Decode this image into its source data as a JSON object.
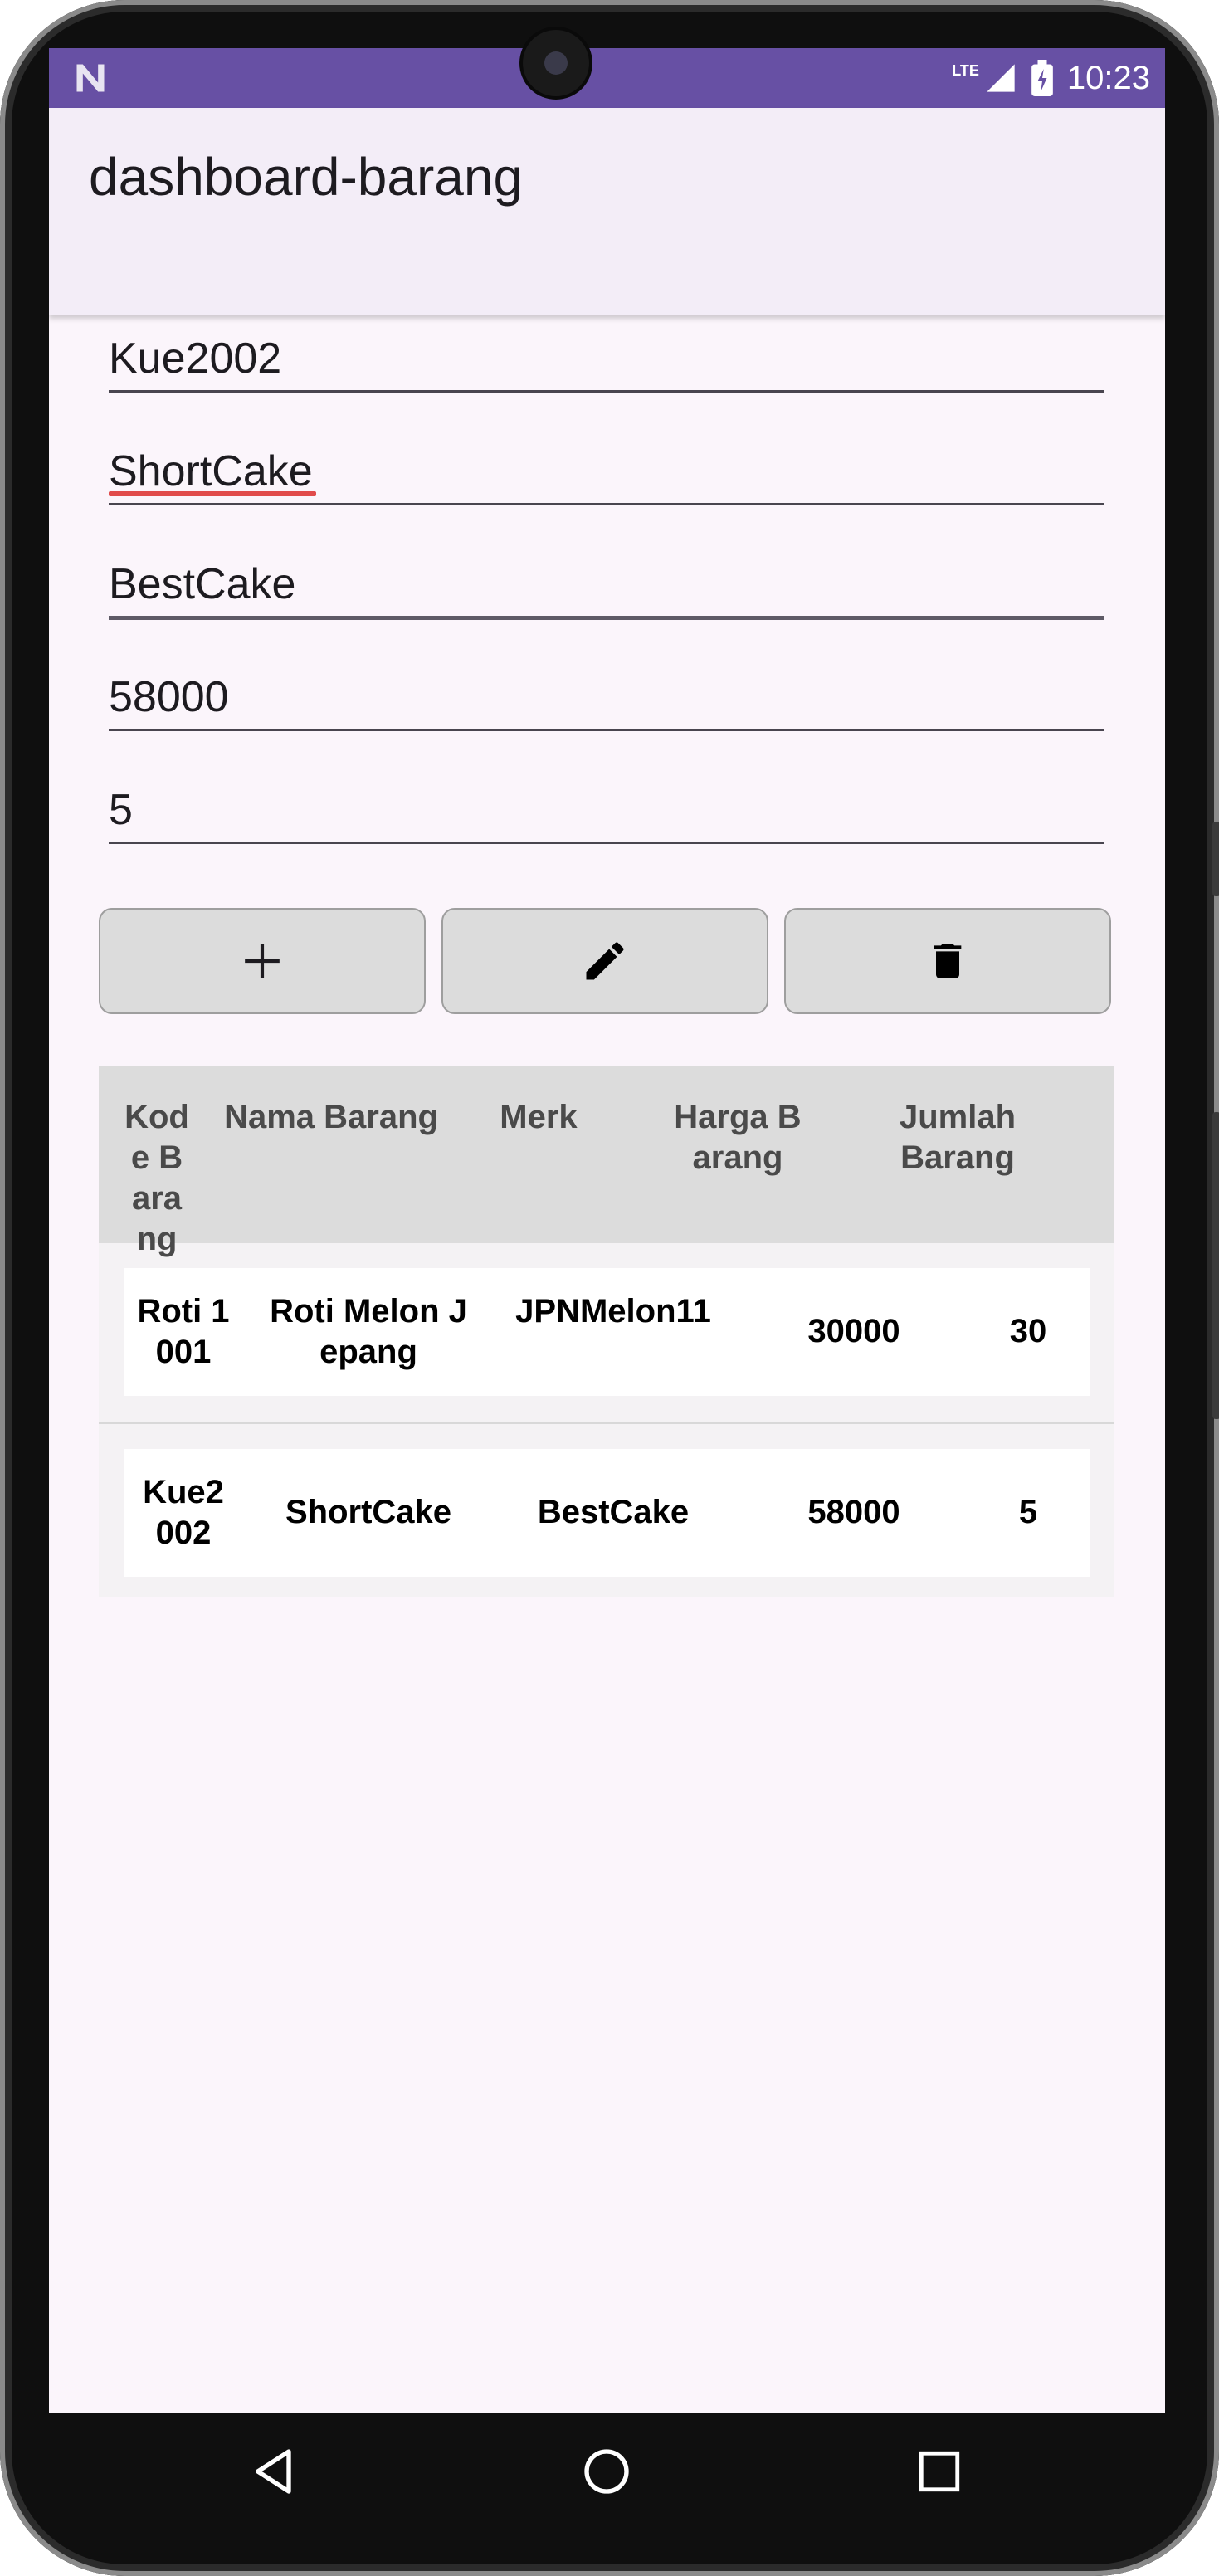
{
  "status_bar": {
    "time": "10:23",
    "network": "LTE",
    "colors": {
      "background": "#6750a4"
    }
  },
  "app_bar": {
    "title": "dashboard-barang"
  },
  "form": {
    "kode_barang": "Kue2002",
    "nama_barang": "ShortCake",
    "merk": "BestCake",
    "harga_barang": "58000",
    "jumlah_barang": "5"
  },
  "buttons": {
    "add_icon": "plus-icon",
    "edit_icon": "pencil-icon",
    "delete_icon": "trash-icon"
  },
  "table": {
    "headers": [
      "Kode Barang",
      "Nama Barang",
      "Merk",
      "Harga Barang",
      "Jumlah Barang"
    ],
    "rows": [
      [
        "Roti 1001",
        "Roti Melon Jepang",
        "JPNMelon11",
        "30000",
        "30"
      ],
      [
        "Kue2002",
        "ShortCake",
        "BestCake",
        "58000",
        "5"
      ]
    ]
  },
  "nav": {
    "icons": [
      "back-icon",
      "home-icon",
      "recents-icon"
    ]
  }
}
